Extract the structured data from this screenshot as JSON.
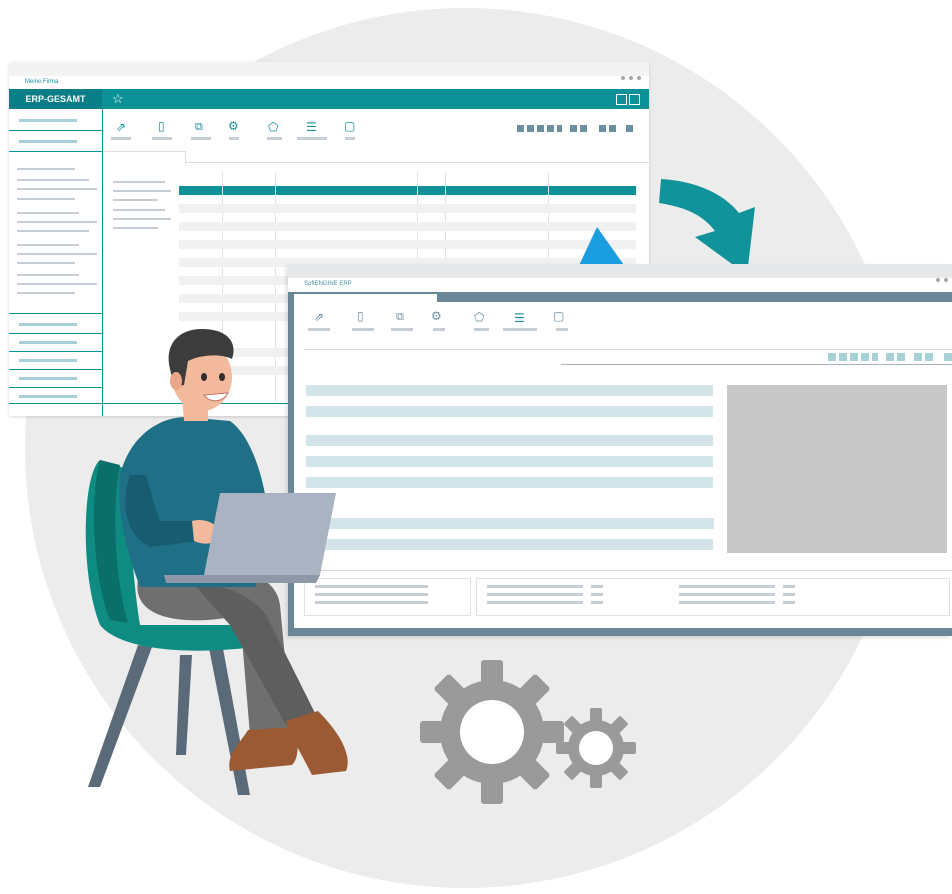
{
  "back_window": {
    "company": "Meine Firma",
    "brand": "ERP-GESAMT",
    "icons": [
      "export-icon",
      "document-icon",
      "copy-icon",
      "gears-icon",
      "tag-icon",
      "list-icon",
      "blank-icon"
    ]
  },
  "front_window": {
    "company": "SoftENGINE ERP",
    "icons": [
      "export-icon",
      "document-icon",
      "copy-icon",
      "gears-icon",
      "tag-icon",
      "list-icon",
      "blank-icon"
    ]
  },
  "colors": {
    "teal": "#0c9199",
    "arrow_teal": "#10939b",
    "arrow_blue": "#1a9ee0",
    "slate": "#6b8796",
    "gear": "#9a9a9a"
  }
}
